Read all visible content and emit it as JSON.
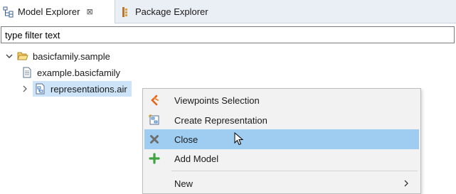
{
  "tabs": [
    {
      "label": "Model Explorer",
      "icon": "model-explorer-icon",
      "active": true
    },
    {
      "label": "Package Explorer",
      "icon": "package-explorer-icon",
      "active": false
    }
  ],
  "filter": {
    "value": "type filter text"
  },
  "tree": [
    {
      "label": "basicfamily.sample",
      "icon": "open-folder-icon",
      "expanded": true
    },
    {
      "label": "example.basicfamily",
      "icon": "file-icon"
    },
    {
      "label": "representations.air",
      "icon": "aird-file-icon",
      "selected": true
    }
  ],
  "context_menu": {
    "items": [
      {
        "label": "Viewpoints Selection",
        "icon": "viewpoints-icon"
      },
      {
        "label": "Create Representation",
        "icon": "create-representation-icon"
      },
      {
        "label": "Close",
        "icon": "close-icon",
        "hovered": true
      },
      {
        "label": "Add Model",
        "icon": "add-icon"
      },
      {
        "label": "New",
        "icon": "",
        "submenu": true
      }
    ]
  },
  "colors": {
    "hover": "#9fcdf2",
    "selection": "#cce3f8",
    "accent": "#e8641c"
  }
}
